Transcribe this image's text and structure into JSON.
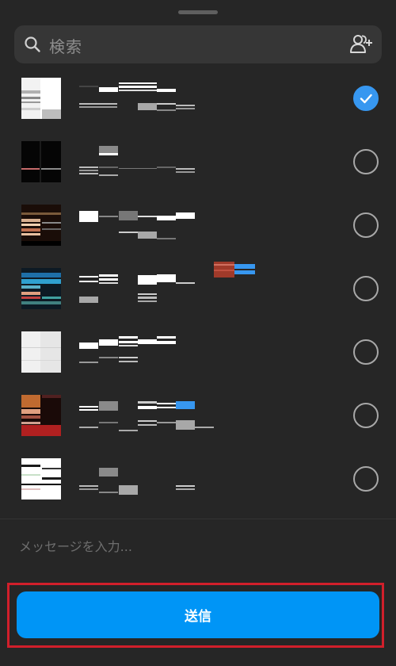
{
  "search": {
    "placeholder": "検索",
    "icon": "search-icon",
    "add_people_icon": "add-people-icon"
  },
  "recipients": [
    {
      "selected": true
    },
    {
      "selected": false
    },
    {
      "selected": false
    },
    {
      "selected": false
    },
    {
      "selected": false
    },
    {
      "selected": false
    },
    {
      "selected": false
    }
  ],
  "message": {
    "placeholder": "メッセージを入力..."
  },
  "send": {
    "label": "送信"
  },
  "colors": {
    "sheet_bg": "#262626",
    "search_bg": "#363636",
    "accent": "#0095f6",
    "check": "#3797f0",
    "highlight": "#d11f2b"
  }
}
